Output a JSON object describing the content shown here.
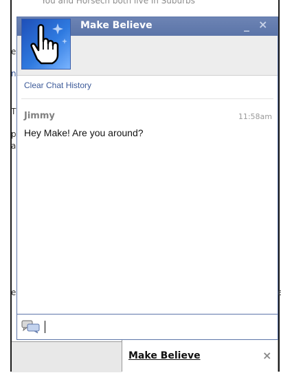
{
  "chat_window": {
    "title": "Make Believe",
    "minimize_label": "_",
    "close_label": "×",
    "avatar_icon": "hand-pointer-icon",
    "clear_history_label": "Clear Chat History",
    "messages": [
      {
        "sender": "Jimmy",
        "time": "11:58am",
        "text": "Hey Make! Are you around?"
      }
    ],
    "input": {
      "value": "",
      "placeholder": ""
    },
    "input_icon": "chat-bubbles-icon"
  },
  "dock": {
    "tab_name": "Make Believe",
    "status_icon": "idle-moon-icon",
    "close_label": "×"
  },
  "background_page": {
    "top_text": "You and Horsech both live in Suburbs"
  },
  "colors": {
    "titlebar": "#5b74a8",
    "link": "#3b5998",
    "sender": "#808080"
  }
}
